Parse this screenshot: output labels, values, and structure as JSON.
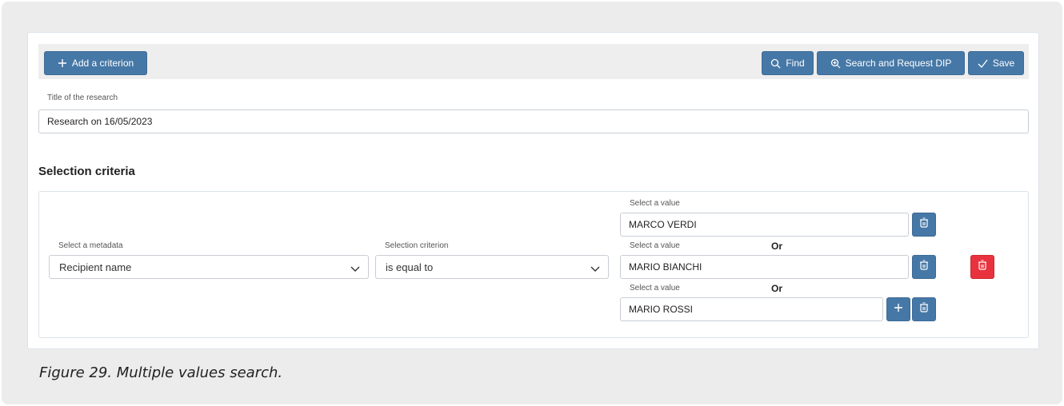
{
  "toolbar": {
    "add_label": "Add a criterion",
    "find_label": "Find",
    "search_dip_label": "Search and Request DIP",
    "save_label": "Save"
  },
  "research": {
    "title_label": "Title of the research",
    "title_value": "Research on 16/05/2023"
  },
  "criteria": {
    "section_title": "Selection criteria",
    "metadata_label": "Select a metadata",
    "metadata_value": "Recipient name",
    "criterion_label": "Selection criterion",
    "criterion_value": "is equal to",
    "values": [
      {
        "label": "Select a value",
        "or": "",
        "value": "MARCO VERDI"
      },
      {
        "label": "Select a value",
        "or": "Or",
        "value": "MARIO BIANCHI"
      },
      {
        "label": "Select a value",
        "or": "Or",
        "value": "MARIO ROSSI"
      }
    ]
  },
  "caption": "Figure 29. Multiple values search.",
  "icons": {
    "add": "plus-icon",
    "find": "search-icon",
    "search_dip": "zoom-plus-icon",
    "save": "check-icon",
    "remove": "trash-icon",
    "dropdown": "chevron-down-icon"
  },
  "colors": {
    "primary": "#4678a7",
    "danger": "#e8333e",
    "toolbar_bg": "#eeeeee",
    "page_bg": "#ececec"
  }
}
